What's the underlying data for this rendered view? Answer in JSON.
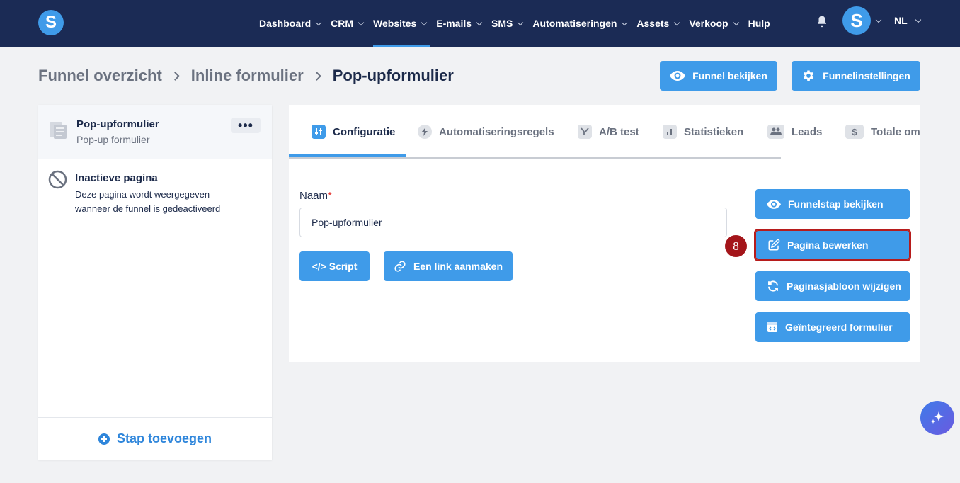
{
  "nav": {
    "logo": "S",
    "items": [
      {
        "label": "Dashboard"
      },
      {
        "label": "CRM"
      },
      {
        "label": "Websites"
      },
      {
        "label": "E-mails"
      },
      {
        "label": "SMS"
      },
      {
        "label": "Automatiseringen"
      },
      {
        "label": "Assets"
      },
      {
        "label": "Verkoop"
      },
      {
        "label": "Hulp"
      }
    ],
    "active": "Websites",
    "avatar": "S",
    "language": "NL"
  },
  "breadcrumb": {
    "item1": "Funnel overzicht",
    "item2": "Inline formulier",
    "current": "Pop-upformulier"
  },
  "header_buttons": {
    "view_funnel": "Funnel bekijken",
    "funnel_settings": "Funnelinstellingen"
  },
  "sidebar": {
    "step_title": "Pop-upformulier",
    "step_subtitle": "Pop-up formulier",
    "more": "•••",
    "inactive_title": "Inactieve pagina",
    "inactive_desc": "Deze pagina wordt weergegeven wanneer de funnel is gedeactiveerd",
    "add_step": "Stap toevoegen"
  },
  "tabs": [
    {
      "label": "Configuratie"
    },
    {
      "label": "Automatiseringsregels"
    },
    {
      "label": "A/B test"
    },
    {
      "label": "Statistieken"
    },
    {
      "label": "Leads"
    },
    {
      "label": "Totale omzet"
    }
  ],
  "form": {
    "naam_label": "Naam",
    "required_mark": "*",
    "naam_value": "Pop-upformulier",
    "script_button": "</> Script",
    "link_button": "Een link aanmaken"
  },
  "actions": {
    "view_step": "Funnelstap bekijken",
    "edit_page": "Pagina bewerken",
    "change_template": "Paginasjabloon wijzigen",
    "integrated_form": "Geïntegreerd formulier"
  },
  "annotation": {
    "step_number": "8"
  },
  "colors": {
    "nav_bg": "#1b2b55",
    "accent": "#3f9be9",
    "highlight": "#b71c1c"
  }
}
